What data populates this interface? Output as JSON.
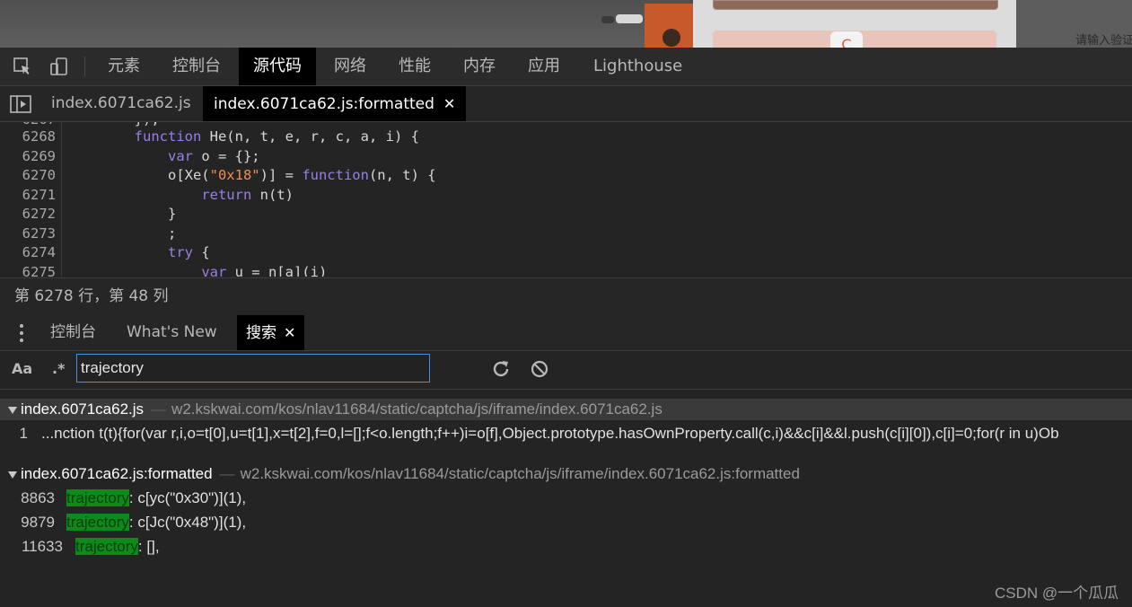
{
  "webpage": {
    "hint_text": "请输入验证"
  },
  "devtools": {
    "panel_tabs": [
      "元素",
      "控制台",
      "源代码",
      "网络",
      "性能",
      "内存",
      "应用",
      "Lighthouse"
    ],
    "active_panel": "源代码",
    "file_tabs": [
      "index.6071ca62.js",
      "index.6071ca62.js:formatted"
    ],
    "active_file": "index.6071ca62.js:formatted",
    "code": {
      "lines": [
        {
          "num": "6268",
          "text": "        function He(n, t, e, r, c, a, i) {"
        },
        {
          "num": "6269",
          "text": "            var o = {};"
        },
        {
          "num": "6270",
          "text": "            o[Xe(\"0x18\")] = function(n, t) {"
        },
        {
          "num": "6271",
          "text": "                return n(t)"
        },
        {
          "num": "6272",
          "text": "            }"
        },
        {
          "num": "6273",
          "text": "            ;"
        },
        {
          "num": "6274",
          "text": "            try {"
        },
        {
          "num": "6275",
          "text": "                var u = n[a](i)"
        }
      ]
    },
    "status_text": "第 6278 行，第 48 列",
    "drawer_tabs": [
      "控制台",
      "What's New",
      "搜索"
    ],
    "active_drawer": "搜索",
    "search": {
      "case_toggle": "Aa",
      "regex_toggle": ".*",
      "query": "trajectory"
    },
    "results": [
      {
        "file": "index.6071ca62.js",
        "path": "w2.kskwai.com/kos/nlav11684/static/captcha/js/iframe/index.6071ca62.js",
        "matches": [
          {
            "line": "1",
            "before": "...nction t(t){for(var r,i,o=t[0],u=t[1],x=t[2],f=0,l=[];f<o.length;f++)i=o[f],Object.prototype.hasOwnProperty.call(c,i)&&c[i]&&l.push(c[i][0]),c[i]=0;for(r in u)Ob",
            "hit": "",
            "after": ""
          }
        ]
      },
      {
        "file": "index.6071ca62.js:formatted",
        "path": "w2.kskwai.com/kos/nlav11684/static/captcha/js/iframe/index.6071ca62.js:formatted",
        "matches": [
          {
            "line": "8863",
            "before": "",
            "hit": "trajectory",
            "after": ": c[yc(\"0x30\")](1),"
          },
          {
            "line": "9879",
            "before": "",
            "hit": "trajectory",
            "after": ": c[Jc(\"0x48\")](1),"
          },
          {
            "line": "11633",
            "before": "",
            "hit": "trajectory",
            "after": ": [],"
          }
        ]
      }
    ]
  },
  "watermark": "CSDN @一个瓜瓜",
  "colors": {
    "highlight": "#0e8a1c",
    "keyword": "#9a7fe8",
    "string": "#f28b54",
    "input_border": "#4a8ee0"
  }
}
